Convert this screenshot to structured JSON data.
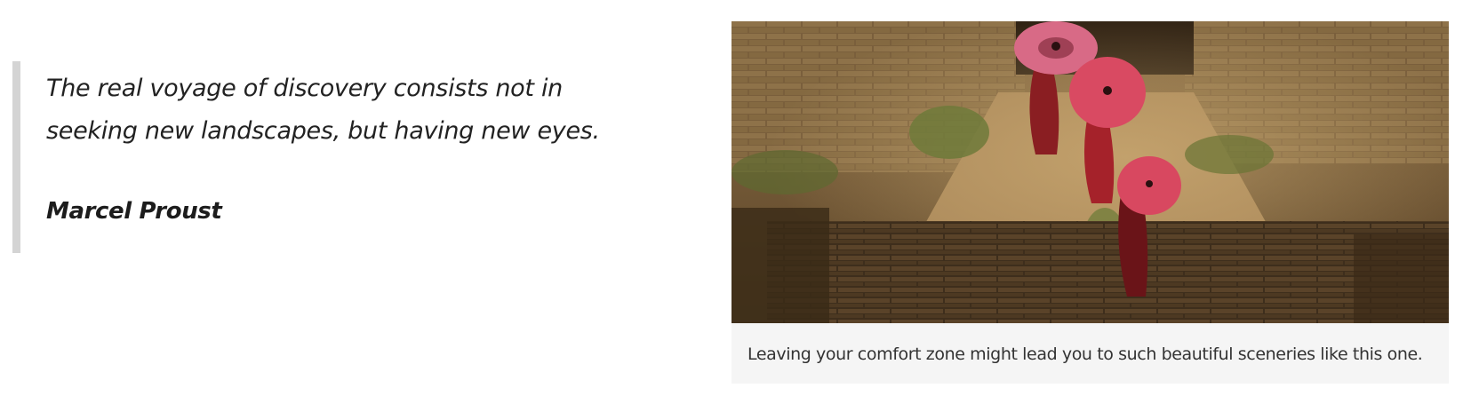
{
  "quote": {
    "text": "The real voyage of discovery consists not in seeking new landscapes, but having new eyes.",
    "author": "Marcel Proust"
  },
  "figure": {
    "caption": "Leaving your comfort zone might lead you to such beautiful sceneries like this one."
  }
}
